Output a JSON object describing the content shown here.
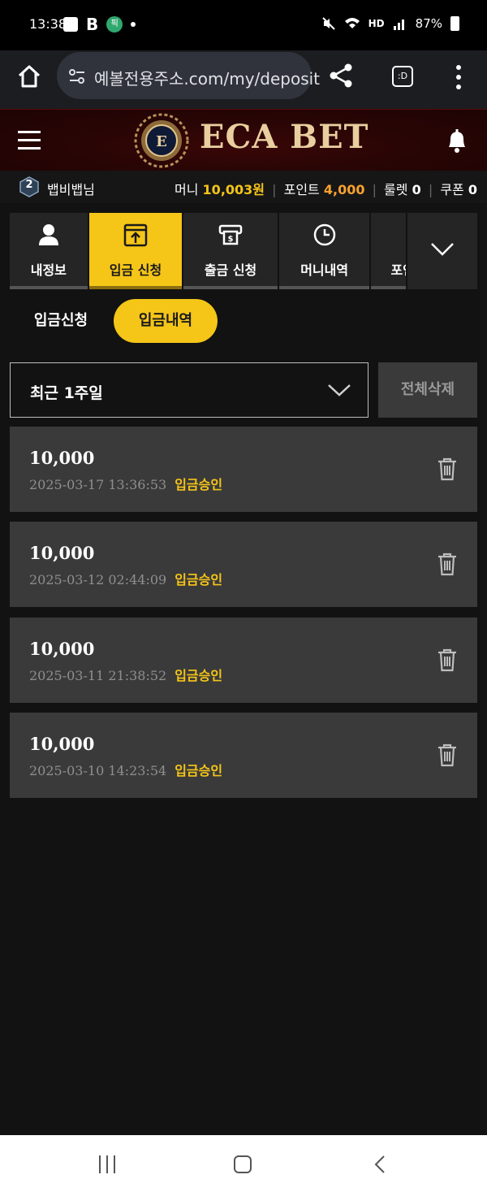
{
  "status_bar": {
    "time": "13:38",
    "sb_b": "B",
    "sb_circle": "픽",
    "network": "HD",
    "battery": "87%"
  },
  "browser": {
    "url": "예볼전용주소.com/my/deposit",
    "tab_label": ":D"
  },
  "header": {
    "logo_text": "ECA BET",
    "emblem_letter": "E"
  },
  "user": {
    "level": "2",
    "name": "뱁비뱁님",
    "money_label": "머니",
    "money_value": "10,003원",
    "point_label": "포인트",
    "point_value": "4,000",
    "roulette_label": "룰렛",
    "roulette_value": "0",
    "coupon_label": "쿠폰",
    "coupon_value": "0"
  },
  "nav_tabs": [
    {
      "label": "내정보",
      "icon": "user-icon"
    },
    {
      "label": "입금 신청",
      "icon": "deposit-icon"
    },
    {
      "label": "출금 신청",
      "icon": "withdraw-icon"
    },
    {
      "label": "머니내역",
      "icon": "clock-icon"
    },
    {
      "label": "포인",
      "icon": ""
    }
  ],
  "sub_tabs": {
    "request": "입금신청",
    "history": "입금내역"
  },
  "filter": {
    "period": "최근 1주일",
    "delete_all": "전체삭제"
  },
  "deposits": [
    {
      "amount": "10,000",
      "datetime": "2025-03-17 13:36:53",
      "status": "입금승인"
    },
    {
      "amount": "10,000",
      "datetime": "2025-03-12 02:44:09",
      "status": "입금승인"
    },
    {
      "amount": "10,000",
      "datetime": "2025-03-11 21:38:52",
      "status": "입금승인"
    },
    {
      "amount": "10,000",
      "datetime": "2025-03-10 14:23:54",
      "status": "입금승인"
    }
  ],
  "colors": {
    "accent": "#f5c518",
    "point": "#f7a22e",
    "header_bg": "#2a0505",
    "card_bg": "#3a3a3a"
  }
}
